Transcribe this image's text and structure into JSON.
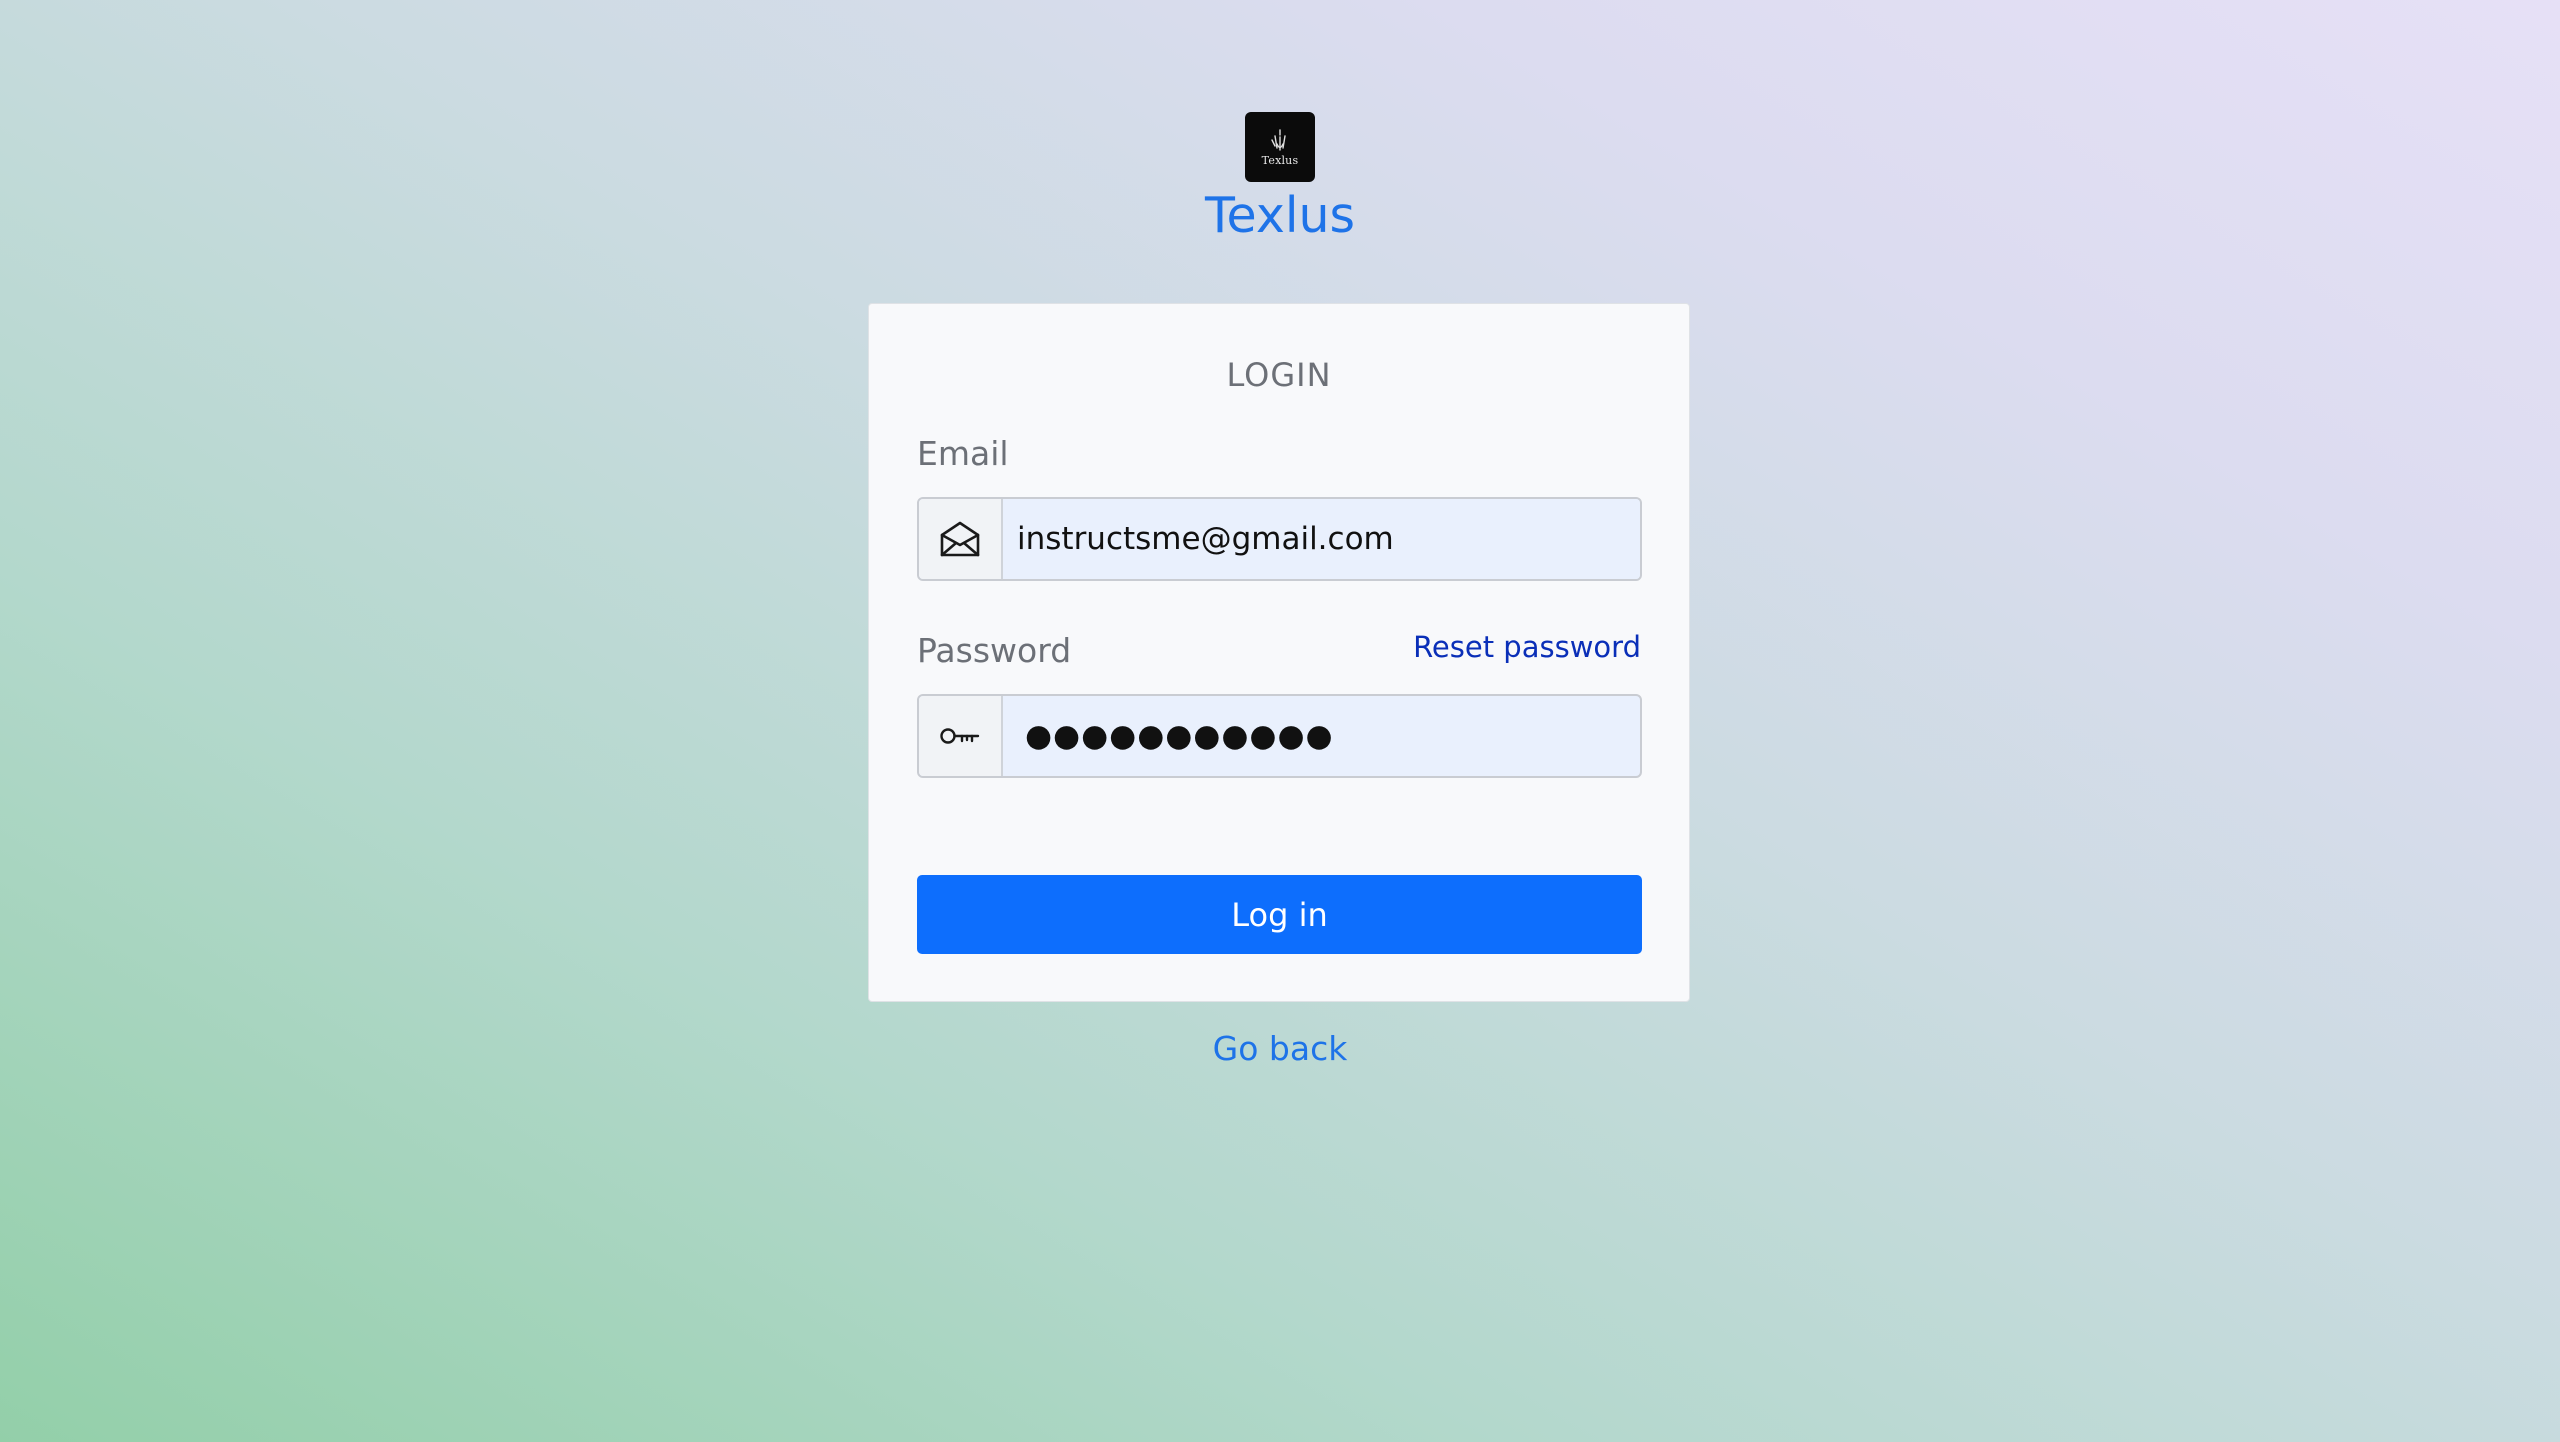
{
  "logo": {
    "icon": "hand-logo-icon",
    "text": "Texlus"
  },
  "brand": {
    "title": "Texlus",
    "color": "#1e73e8"
  },
  "login_card": {
    "title": "LOGIN",
    "email": {
      "label": "Email",
      "value": "instructsme@gmail.com",
      "icon": "envelope-open-icon"
    },
    "password": {
      "label": "Password",
      "masked_value": "●●●●●●●●●●●",
      "icon": "key-icon"
    },
    "reset_password_label": "Reset password",
    "login_button_label": "Log in",
    "button_color": "#0d6efd"
  },
  "go_back_label": "Go back"
}
